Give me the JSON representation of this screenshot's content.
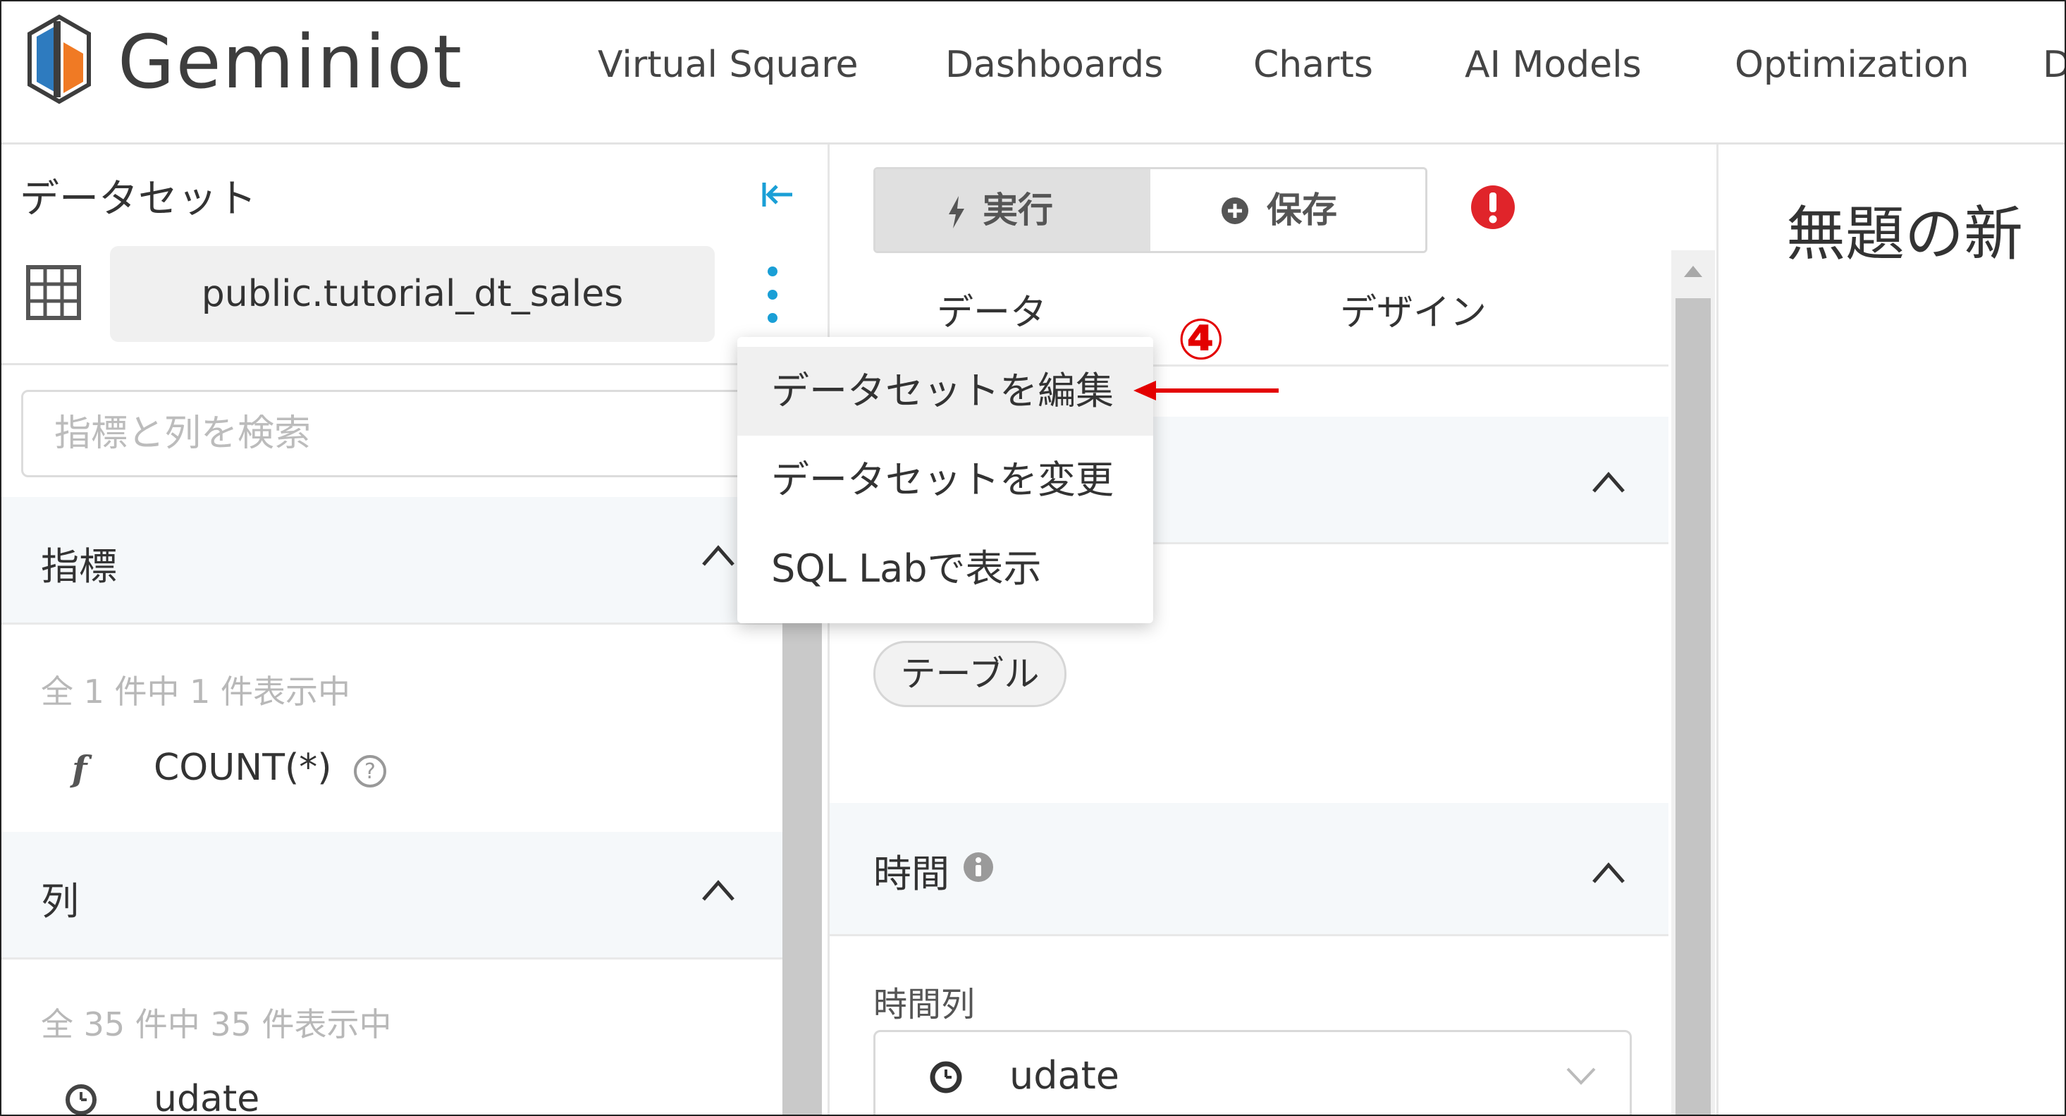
{
  "brand": {
    "name": "Geminiot"
  },
  "nav": [
    "Virtual Square",
    "Dashboards",
    "Charts",
    "AI Models",
    "Optimization",
    "D"
  ],
  "left_panel": {
    "title": "データセット",
    "dataset_name": "public.tutorial_dt_sales",
    "search_placeholder": "指標と列を検索",
    "metrics": {
      "label": "指標",
      "count_text": "全 1 件中 1 件表示中",
      "items": [
        {
          "icon": "f",
          "name": "COUNT(*)"
        }
      ]
    },
    "columns": {
      "label": "列",
      "count_text": "全 35 件中 35 件表示中",
      "items": [
        {
          "icon": "clock-icon",
          "name": "udate"
        }
      ]
    }
  },
  "middle_panel": {
    "run_label": "実行",
    "save_label": "保存",
    "tabs": [
      "データ",
      "デザイン"
    ],
    "viz_type_pill": "テーブル",
    "time_section": {
      "label": "時間",
      "time_column_label": "時間列",
      "time_column_value": "udate"
    }
  },
  "right_panel": {
    "chart_title": "無題の新"
  },
  "dropdown_menu": {
    "items": [
      "データセットを編集",
      "データセットを変更",
      "SQL Labで表示"
    ],
    "highlighted_index": 0
  },
  "annotation": {
    "number": "④",
    "color": "#e30000"
  },
  "colors": {
    "accent": "#1a9fd6",
    "alert": "#e0242a",
    "logo_orange": "#f07a24",
    "logo_blue": "#2e7bbf"
  }
}
